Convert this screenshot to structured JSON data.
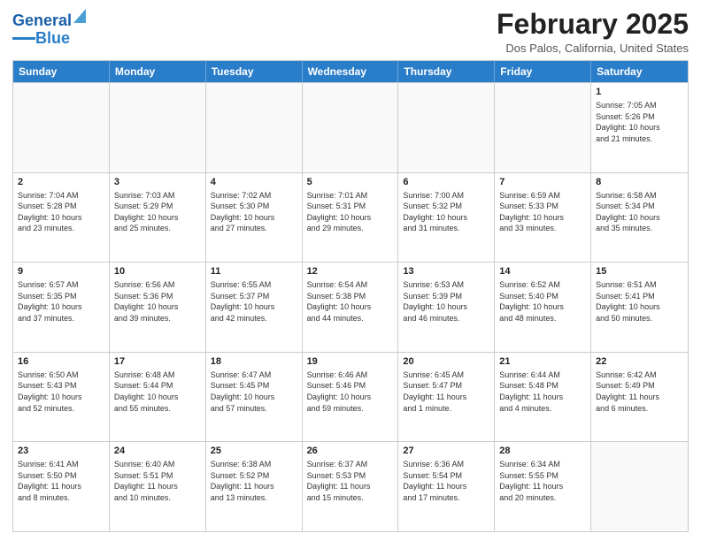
{
  "header": {
    "logo_line1": "General",
    "logo_line2": "Blue",
    "month_year": "February 2025",
    "location": "Dos Palos, California, United States"
  },
  "days_of_week": [
    "Sunday",
    "Monday",
    "Tuesday",
    "Wednesday",
    "Thursday",
    "Friday",
    "Saturday"
  ],
  "weeks": [
    [
      {
        "day": "",
        "info": ""
      },
      {
        "day": "",
        "info": ""
      },
      {
        "day": "",
        "info": ""
      },
      {
        "day": "",
        "info": ""
      },
      {
        "day": "",
        "info": ""
      },
      {
        "day": "",
        "info": ""
      },
      {
        "day": "1",
        "info": "Sunrise: 7:05 AM\nSunset: 5:26 PM\nDaylight: 10 hours\nand 21 minutes."
      }
    ],
    [
      {
        "day": "2",
        "info": "Sunrise: 7:04 AM\nSunset: 5:28 PM\nDaylight: 10 hours\nand 23 minutes."
      },
      {
        "day": "3",
        "info": "Sunrise: 7:03 AM\nSunset: 5:29 PM\nDaylight: 10 hours\nand 25 minutes."
      },
      {
        "day": "4",
        "info": "Sunrise: 7:02 AM\nSunset: 5:30 PM\nDaylight: 10 hours\nand 27 minutes."
      },
      {
        "day": "5",
        "info": "Sunrise: 7:01 AM\nSunset: 5:31 PM\nDaylight: 10 hours\nand 29 minutes."
      },
      {
        "day": "6",
        "info": "Sunrise: 7:00 AM\nSunset: 5:32 PM\nDaylight: 10 hours\nand 31 minutes."
      },
      {
        "day": "7",
        "info": "Sunrise: 6:59 AM\nSunset: 5:33 PM\nDaylight: 10 hours\nand 33 minutes."
      },
      {
        "day": "8",
        "info": "Sunrise: 6:58 AM\nSunset: 5:34 PM\nDaylight: 10 hours\nand 35 minutes."
      }
    ],
    [
      {
        "day": "9",
        "info": "Sunrise: 6:57 AM\nSunset: 5:35 PM\nDaylight: 10 hours\nand 37 minutes."
      },
      {
        "day": "10",
        "info": "Sunrise: 6:56 AM\nSunset: 5:36 PM\nDaylight: 10 hours\nand 39 minutes."
      },
      {
        "day": "11",
        "info": "Sunrise: 6:55 AM\nSunset: 5:37 PM\nDaylight: 10 hours\nand 42 minutes."
      },
      {
        "day": "12",
        "info": "Sunrise: 6:54 AM\nSunset: 5:38 PM\nDaylight: 10 hours\nand 44 minutes."
      },
      {
        "day": "13",
        "info": "Sunrise: 6:53 AM\nSunset: 5:39 PM\nDaylight: 10 hours\nand 46 minutes."
      },
      {
        "day": "14",
        "info": "Sunrise: 6:52 AM\nSunset: 5:40 PM\nDaylight: 10 hours\nand 48 minutes."
      },
      {
        "day": "15",
        "info": "Sunrise: 6:51 AM\nSunset: 5:41 PM\nDaylight: 10 hours\nand 50 minutes."
      }
    ],
    [
      {
        "day": "16",
        "info": "Sunrise: 6:50 AM\nSunset: 5:43 PM\nDaylight: 10 hours\nand 52 minutes."
      },
      {
        "day": "17",
        "info": "Sunrise: 6:48 AM\nSunset: 5:44 PM\nDaylight: 10 hours\nand 55 minutes."
      },
      {
        "day": "18",
        "info": "Sunrise: 6:47 AM\nSunset: 5:45 PM\nDaylight: 10 hours\nand 57 minutes."
      },
      {
        "day": "19",
        "info": "Sunrise: 6:46 AM\nSunset: 5:46 PM\nDaylight: 10 hours\nand 59 minutes."
      },
      {
        "day": "20",
        "info": "Sunrise: 6:45 AM\nSunset: 5:47 PM\nDaylight: 11 hours\nand 1 minute."
      },
      {
        "day": "21",
        "info": "Sunrise: 6:44 AM\nSunset: 5:48 PM\nDaylight: 11 hours\nand 4 minutes."
      },
      {
        "day": "22",
        "info": "Sunrise: 6:42 AM\nSunset: 5:49 PM\nDaylight: 11 hours\nand 6 minutes."
      }
    ],
    [
      {
        "day": "23",
        "info": "Sunrise: 6:41 AM\nSunset: 5:50 PM\nDaylight: 11 hours\nand 8 minutes."
      },
      {
        "day": "24",
        "info": "Sunrise: 6:40 AM\nSunset: 5:51 PM\nDaylight: 11 hours\nand 10 minutes."
      },
      {
        "day": "25",
        "info": "Sunrise: 6:38 AM\nSunset: 5:52 PM\nDaylight: 11 hours\nand 13 minutes."
      },
      {
        "day": "26",
        "info": "Sunrise: 6:37 AM\nSunset: 5:53 PM\nDaylight: 11 hours\nand 15 minutes."
      },
      {
        "day": "27",
        "info": "Sunrise: 6:36 AM\nSunset: 5:54 PM\nDaylight: 11 hours\nand 17 minutes."
      },
      {
        "day": "28",
        "info": "Sunrise: 6:34 AM\nSunset: 5:55 PM\nDaylight: 11 hours\nand 20 minutes."
      },
      {
        "day": "",
        "info": ""
      }
    ]
  ]
}
